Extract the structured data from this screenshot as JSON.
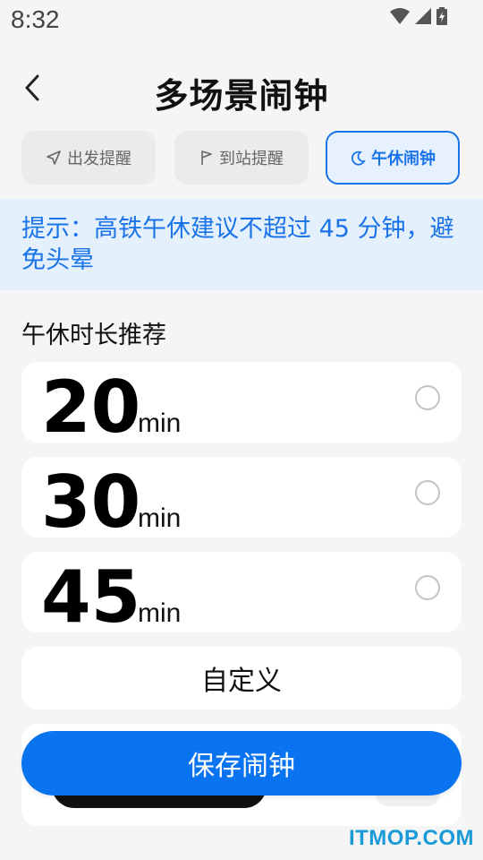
{
  "status_bar": {
    "time": "8:32"
  },
  "header": {
    "title": "多场景闹钟"
  },
  "tabs": [
    {
      "label": "出发提醒",
      "icon": "navigation-arrow-icon",
      "active": false
    },
    {
      "label": "到站提醒",
      "icon": "flag-icon",
      "active": false
    },
    {
      "label": "午休闹钟",
      "icon": "moon-icon",
      "active": true
    }
  ],
  "tip": {
    "text": "提示：高铁午休建议不超过 45 分钟，避免头晕"
  },
  "section": {
    "title": "午休时长推荐"
  },
  "options": [
    {
      "value": "20",
      "unit": "min",
      "selected": false
    },
    {
      "value": "30",
      "unit": "min",
      "selected": false
    },
    {
      "value": "45",
      "unit": "min",
      "selected": false
    }
  ],
  "custom": {
    "label": "自定义"
  },
  "save": {
    "label": "保存闹钟"
  },
  "watermark": {
    "text": "ITMOP.COM"
  },
  "colors": {
    "accent": "#1a73e8",
    "button": "#0a74f0",
    "tip_bg": "#e4f0fc",
    "background": "#f5f5f5"
  }
}
